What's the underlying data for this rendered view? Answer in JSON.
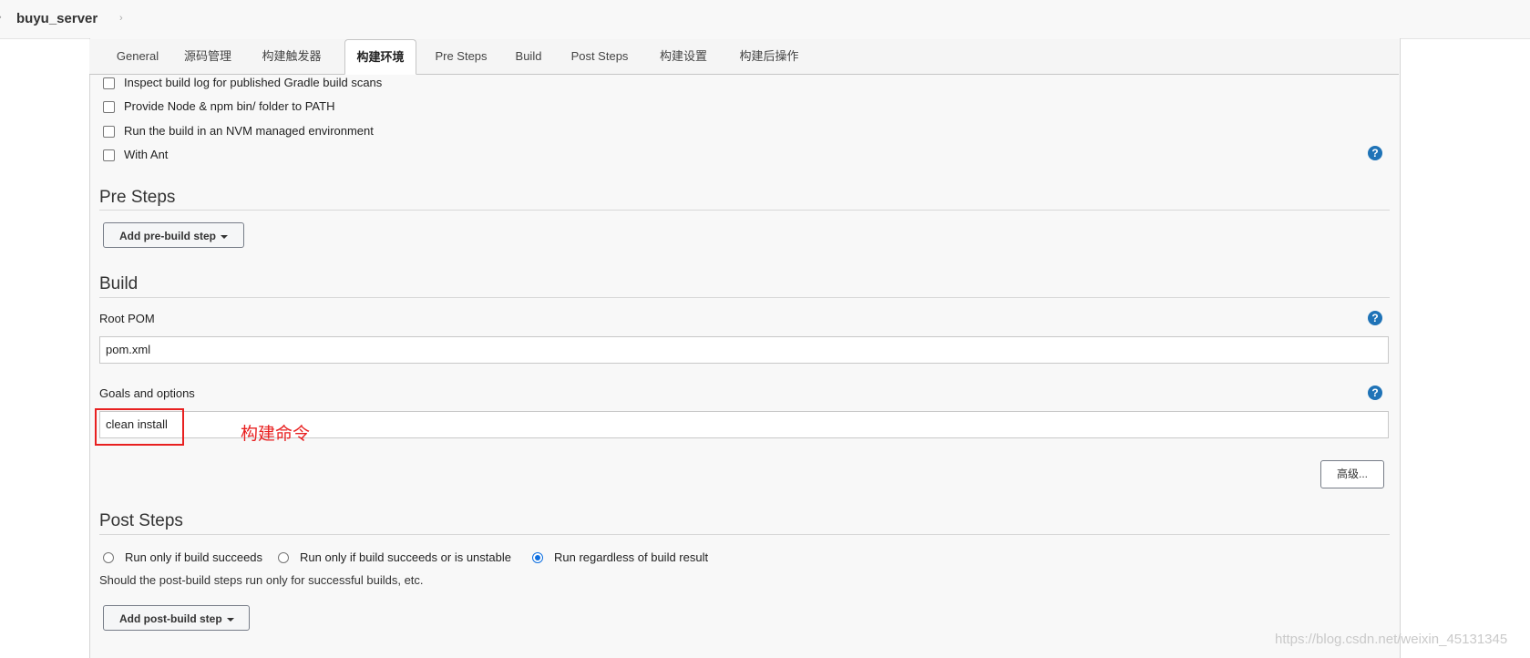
{
  "breadcrumb": {
    "title": "buyu_server"
  },
  "tabs": [
    {
      "label": "General"
    },
    {
      "label": "源码管理"
    },
    {
      "label": "构建触发器"
    },
    {
      "label": "构建环境"
    },
    {
      "label": "Pre Steps"
    },
    {
      "label": "Build"
    },
    {
      "label": "Post Steps"
    },
    {
      "label": "构建设置"
    },
    {
      "label": "构建后操作"
    }
  ],
  "active_tab": "构建环境",
  "build_env": {
    "options": [
      {
        "label": "Inspect build log for published Gradle build scans",
        "checked": false
      },
      {
        "label": "Provide Node & npm bin/ folder to PATH",
        "checked": false
      },
      {
        "label": "Run the build in an NVM managed environment",
        "checked": false
      },
      {
        "label": "With Ant",
        "checked": false
      }
    ]
  },
  "pre_steps": {
    "title": "Pre Steps",
    "add_button": "Add pre-build step"
  },
  "build": {
    "title": "Build",
    "root_pom_label": "Root POM",
    "root_pom_value": "pom.xml",
    "goals_label": "Goals and options",
    "goals_value": "clean install",
    "annotation": "构建命令",
    "advanced_button": "高级..."
  },
  "post_steps": {
    "title": "Post Steps",
    "radios": [
      {
        "label": "Run only if build succeeds",
        "selected": false
      },
      {
        "label": "Run only if build succeeds or is unstable",
        "selected": false
      },
      {
        "label": "Run regardless of build result",
        "selected": true
      }
    ],
    "description": "Should the post-build steps run only for successful builds, etc.",
    "add_button": "Add post-build step"
  },
  "help_icon": "?",
  "watermark": "https://blog.csdn.net/weixin_45131345",
  "colors": {
    "accent": "#1f73b7",
    "annotation": "#e82020",
    "radio_selected": "#0f6fe0"
  }
}
